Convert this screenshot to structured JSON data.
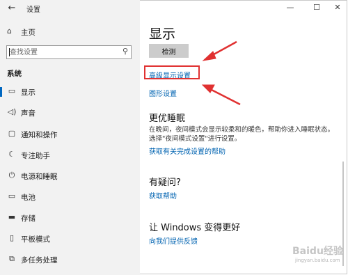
{
  "window": {
    "title": "设置",
    "back_glyph": "←",
    "min_glyph": "—",
    "max_glyph": "☐",
    "close_glyph": "✕"
  },
  "sidebar": {
    "home_label": "主页",
    "search_placeholder": "查找设置",
    "section_title": "系统",
    "items": [
      {
        "label": "显示",
        "icon": "monitor-icon",
        "glyph": "▭",
        "active": true
      },
      {
        "label": "声音",
        "icon": "speaker-icon",
        "glyph": "🔈",
        "active": false
      },
      {
        "label": "通知和操作",
        "icon": "notification-icon",
        "glyph": "▢",
        "active": false
      },
      {
        "label": "专注助手",
        "icon": "moon-icon",
        "glyph": "☾",
        "active": false
      },
      {
        "label": "电源和睡眠",
        "icon": "power-icon",
        "glyph": "⏻",
        "active": false
      },
      {
        "label": "电池",
        "icon": "battery-icon",
        "glyph": "▭",
        "active": false
      },
      {
        "label": "存储",
        "icon": "storage-icon",
        "glyph": "▬",
        "active": false
      },
      {
        "label": "平板模式",
        "icon": "tablet-icon",
        "glyph": "▯",
        "active": false
      },
      {
        "label": "多任务处理",
        "icon": "multitask-icon",
        "glyph": "⧉",
        "active": false
      }
    ]
  },
  "main": {
    "title": "显示",
    "detect_label": "检测",
    "advanced_link": "高级显示设置",
    "graphics_link": "图形设置",
    "sleep_heading": "更优睡眠",
    "sleep_desc": "在晚间，夜间模式会显示较柔和的暖色，帮助你进入睡眠状态。选择\"夜间模式设置\"进行设置。",
    "sleep_help_link": "获取有关完成设置的帮助",
    "question_heading": "有疑问?",
    "help_link": "获取帮助",
    "improve_heading": "让 Windows 变得更好",
    "feedback_link": "向我们提供反馈"
  },
  "watermark": {
    "brand": "Baidu经验",
    "url": "jingyan.baidu.com"
  },
  "colors": {
    "sidebar_bg": "#f2f2f2",
    "accent": "#0067c0",
    "link": "#0063b1",
    "annotation_red": "#e03131"
  }
}
